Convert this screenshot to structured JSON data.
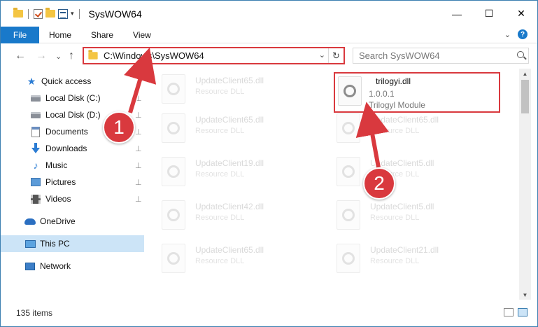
{
  "window": {
    "title": "SysWOW64",
    "minimize": "—",
    "maximize": "☐",
    "close": "✕"
  },
  "ribbon": {
    "tabs": [
      "File",
      "Home",
      "Share",
      "View"
    ],
    "help": "?"
  },
  "address": {
    "path": "C:\\Windows\\SysWOW64",
    "refresh": "↻",
    "dropdown": "⌄"
  },
  "search": {
    "placeholder": "Search SysWOW64"
  },
  "nav": {
    "back": "←",
    "forward": "→",
    "dropdown": "⌄",
    "up": "↑"
  },
  "sidebar": {
    "items": [
      {
        "label": "Quick access",
        "icon": "star-icon",
        "pinned": false
      },
      {
        "label": "Local Disk (C:)",
        "icon": "drive-icon",
        "pinned": true
      },
      {
        "label": "Local Disk (D:)",
        "icon": "drive-icon",
        "pinned": true
      },
      {
        "label": "Documents",
        "icon": "documents-icon",
        "pinned": true
      },
      {
        "label": "Downloads",
        "icon": "downloads-icon",
        "pinned": true
      },
      {
        "label": "Music",
        "icon": "music-icon",
        "pinned": true
      },
      {
        "label": "Pictures",
        "icon": "pictures-icon",
        "pinned": true
      },
      {
        "label": "Videos",
        "icon": "videos-icon",
        "pinned": true
      },
      {
        "label": "OneDrive",
        "icon": "onedrive-icon",
        "pinned": false
      },
      {
        "label": "This PC",
        "icon": "this-pc-icon",
        "pinned": false,
        "selected": true
      },
      {
        "label": "Network",
        "icon": "network-icon",
        "pinned": false
      }
    ],
    "pin_glyph": "📌"
  },
  "files": [
    {
      "name": "UpdateClient65.dll",
      "desc": "Resource DLL"
    },
    {
      "name": "trilogyi.dll",
      "version": "1.0.0.1",
      "desc": "Trilogyl Module",
      "highlighted": true
    },
    {
      "name": "UpdateClient65.dll",
      "desc": "Resource DLL"
    },
    {
      "name": "UpdateClient65.dll",
      "desc": "Resource DLL"
    },
    {
      "name": "UpdateClient19.dll",
      "desc": "Resource DLL"
    },
    {
      "name": "UpdateClient5.dll",
      "desc": "Resource DLL"
    },
    {
      "name": "UpdateClient42.dll",
      "desc": "Resource DLL"
    },
    {
      "name": "UpdateClient5.dll",
      "desc": "Resource DLL"
    },
    {
      "name": "UpdateClient65.dll",
      "desc": "Resource DLL"
    },
    {
      "name": "UpdateClient21.dll",
      "desc": "Resource DLL"
    }
  ],
  "status": {
    "item_count": "135 items"
  },
  "annotations": {
    "step1": "1",
    "step2": "2",
    "color": "#d9393e"
  }
}
